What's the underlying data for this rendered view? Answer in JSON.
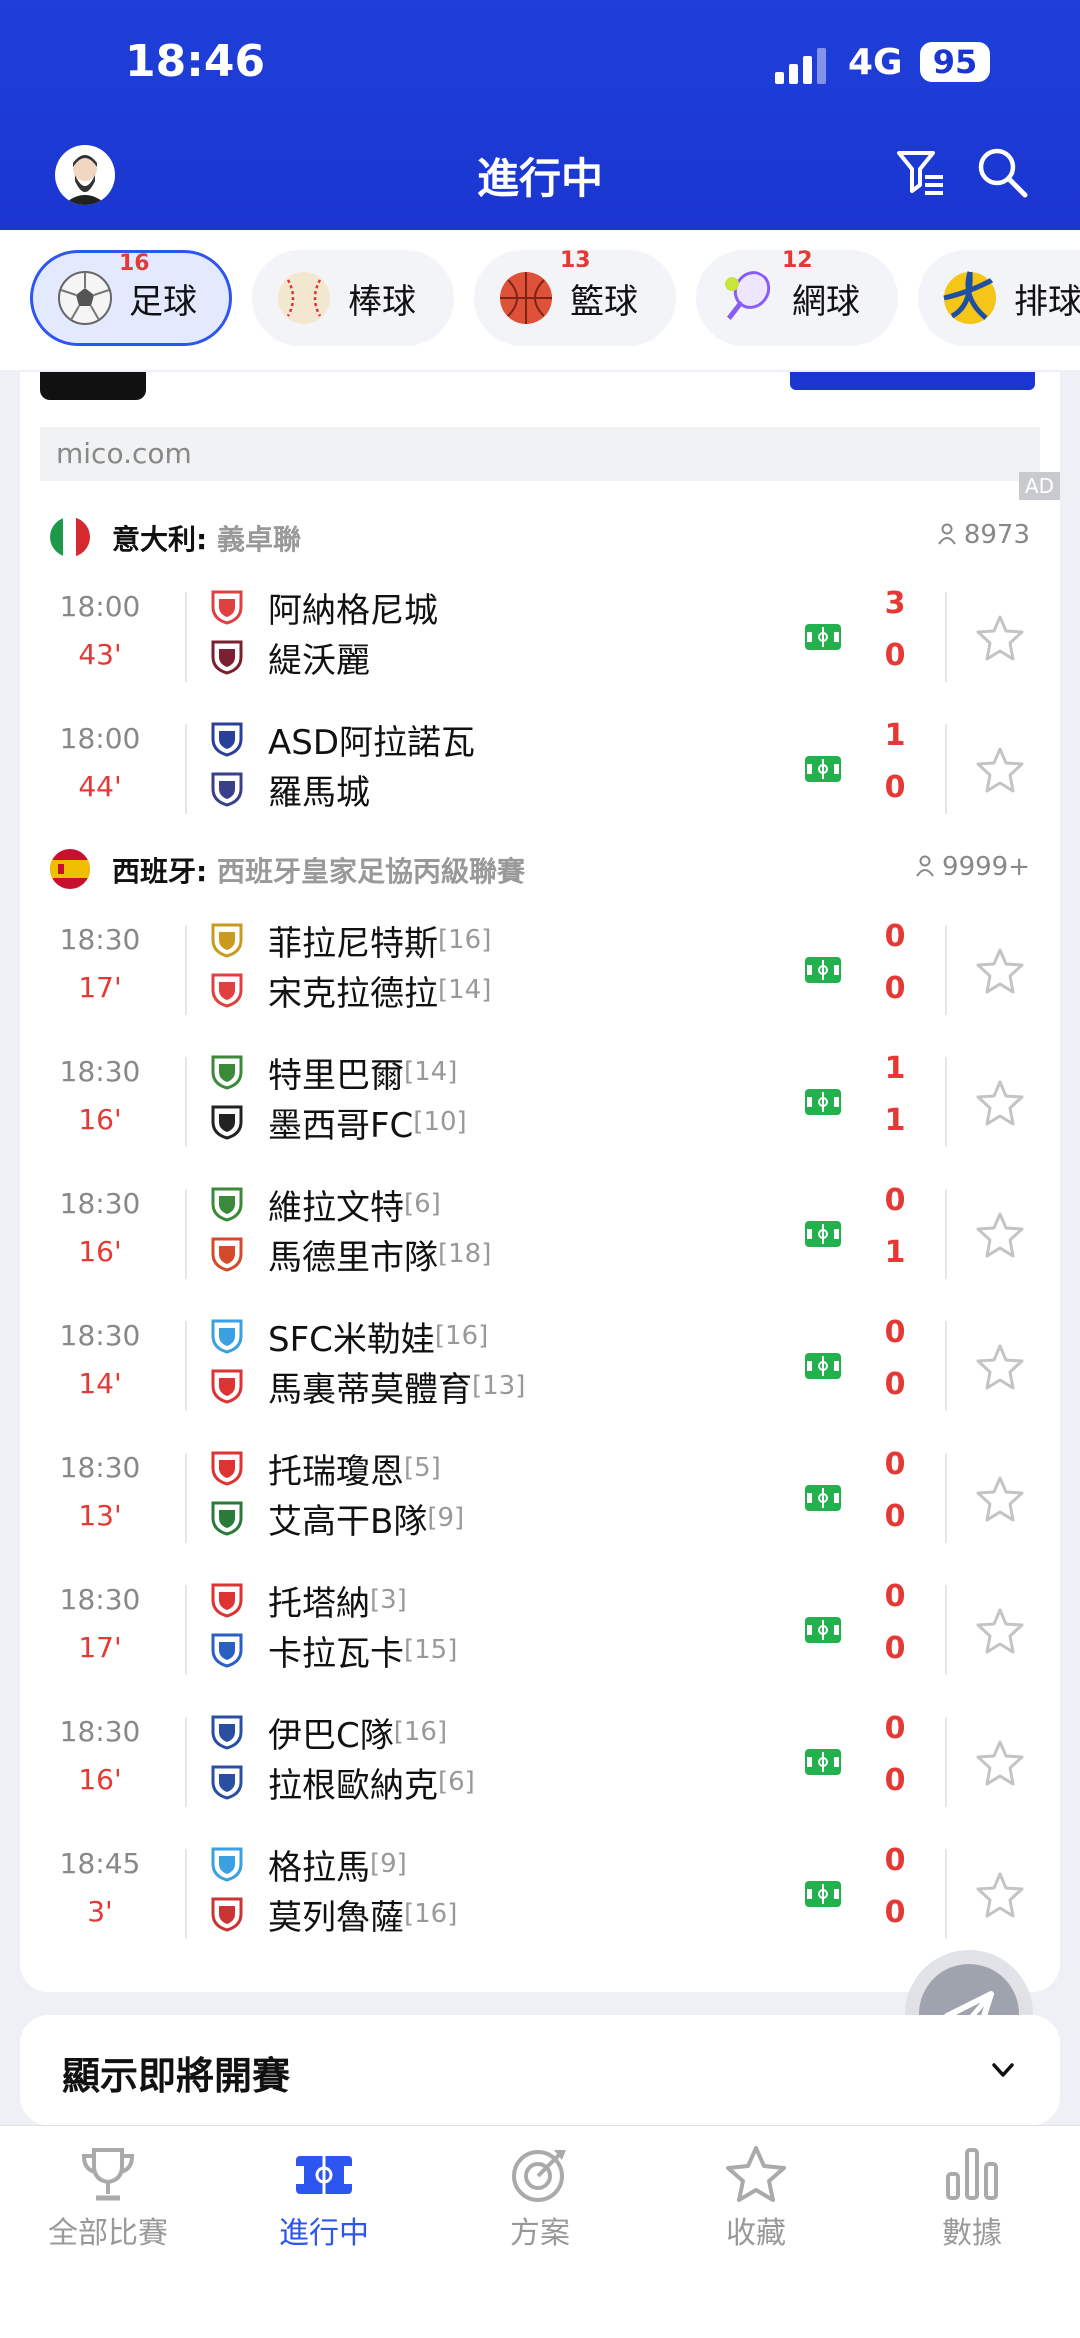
{
  "status_bar": {
    "time": "18:46",
    "network": "4G",
    "battery": "95"
  },
  "header": {
    "title": "進行中"
  },
  "sport_tabs": [
    {
      "label": "足球",
      "count": "16",
      "active": true
    },
    {
      "label": "棒球",
      "count": "",
      "active": false
    },
    {
      "label": "籃球",
      "count": "13",
      "active": false
    },
    {
      "label": "網球",
      "count": "12",
      "active": false
    },
    {
      "label": "排球",
      "count": "",
      "active": false
    }
  ],
  "ad": {
    "url": "mico.com",
    "tag": "AD"
  },
  "leagues": [
    {
      "country": "意大利",
      "sep": ": ",
      "name": "義卓聯",
      "viewers": "8973"
    },
    {
      "country": "西班牙",
      "sep": ": ",
      "name": "西班牙皇家足協丙級聯賽",
      "viewers": "9999+"
    }
  ],
  "matches": [
    {
      "time": "18:00",
      "minute": "43'",
      "home": "阿納格尼城",
      "home_rank": "",
      "away": "緹沃麗",
      "away_rank": "",
      "home_score": "3",
      "away_score": "0"
    },
    {
      "time": "18:00",
      "minute": "44'",
      "home": "ASD阿拉諾瓦",
      "home_rank": "",
      "away": "羅馬城",
      "away_rank": "",
      "home_score": "1",
      "away_score": "0"
    },
    {
      "time": "18:30",
      "minute": "17'",
      "home": "菲拉尼特斯",
      "home_rank": "[16]",
      "away": "宋克拉德拉",
      "away_rank": "[14]",
      "home_score": "0",
      "away_score": "0"
    },
    {
      "time": "18:30",
      "minute": "16'",
      "home": "特里巴爾",
      "home_rank": "[14]",
      "away": "墨西哥FC",
      "away_rank": "[10]",
      "home_score": "1",
      "away_score": "1"
    },
    {
      "time": "18:30",
      "minute": "16'",
      "home": "維拉文特",
      "home_rank": "[6]",
      "away": "馬德里市隊",
      "away_rank": "[18]",
      "home_score": "0",
      "away_score": "1"
    },
    {
      "time": "18:30",
      "minute": "14'",
      "home": "SFC米勒娃",
      "home_rank": "[16]",
      "away": "馬裏蒂莫體育",
      "away_rank": "[13]",
      "home_score": "0",
      "away_score": "0"
    },
    {
      "time": "18:30",
      "minute": "13'",
      "home": "托瑞瓊恩",
      "home_rank": "[5]",
      "away": "艾高干B隊",
      "away_rank": "[9]",
      "home_score": "0",
      "away_score": "0"
    },
    {
      "time": "18:30",
      "minute": "17'",
      "home": "托塔納",
      "home_rank": "[3]",
      "away": "卡拉瓦卡",
      "away_rank": "[15]",
      "home_score": "0",
      "away_score": "0"
    },
    {
      "time": "18:30",
      "minute": "16'",
      "home": "伊巴C隊",
      "home_rank": "[16]",
      "away": "拉根歐納克",
      "away_rank": "[6]",
      "home_score": "0",
      "away_score": "0"
    },
    {
      "time": "18:45",
      "minute": "3'",
      "home": "格拉馬",
      "home_rank": "[9]",
      "away": "莫列魯薩",
      "away_rank": "[16]",
      "home_score": "0",
      "away_score": "0"
    }
  ],
  "upcoming": {
    "label": "顯示即將開賽"
  },
  "bottom_nav": [
    {
      "label": "全部比賽",
      "icon": "trophy-icon"
    },
    {
      "label": "進行中",
      "icon": "live-field-icon",
      "active": true
    },
    {
      "label": "方案",
      "icon": "target-icon"
    },
    {
      "label": "收藏",
      "icon": "star-icon"
    },
    {
      "label": "數據",
      "icon": "bar-chart-icon"
    }
  ],
  "colors": {
    "brand": "#1b36d0",
    "accent": "#2d55f0",
    "score": "#e53935",
    "live_icon": "#22b14c"
  }
}
